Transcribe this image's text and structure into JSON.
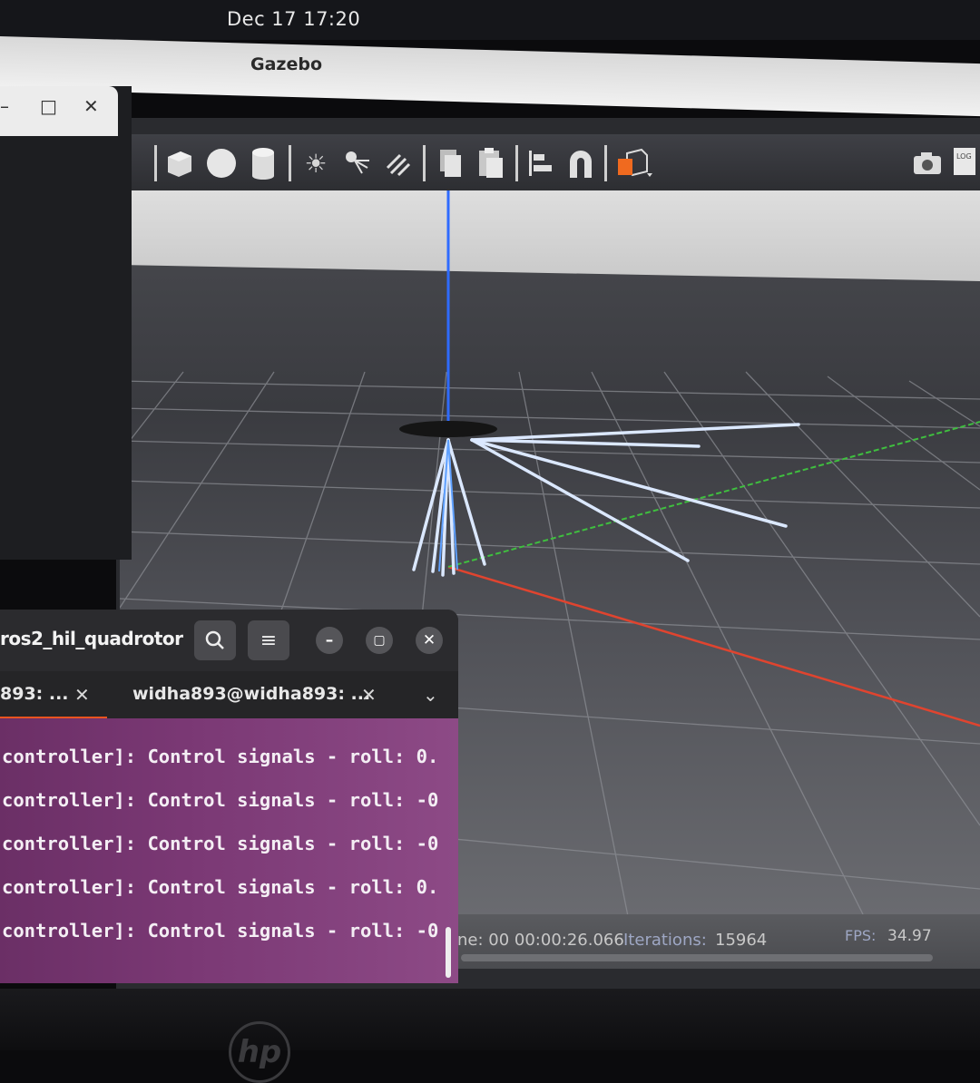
{
  "system_bar": {
    "clock": "Dec 17  17:20"
  },
  "gazebo": {
    "window_title": "Gazebo",
    "toolbar": {
      "tools": [
        "box-icon",
        "sphere-icon",
        "cylinder-icon",
        "point-light-icon",
        "spot-light-icon",
        "directional-light-icon",
        "copy-icon",
        "paste-icon",
        "align-icon",
        "snap-icon",
        "view-angle-icon"
      ],
      "right_tools": [
        "screenshot-icon",
        "log-icon"
      ],
      "log_label": "LOG"
    },
    "status_bar": {
      "sim_time": "ne: 00 00:00:26.066",
      "iterations_label": "Iterations:",
      "iterations_value": "15964",
      "fps_label": "FPS:",
      "fps_value": "34.97"
    },
    "colors": {
      "x_axis": "#e0442f",
      "y_axis": "#3fbf3f",
      "z_axis": "#2f6bff",
      "laser_rays": "#dbe8ff"
    }
  },
  "left_window": {
    "minimize": "–",
    "maximize": "□",
    "close": "✕"
  },
  "terminal": {
    "title": "ros2_hil_quadrotor",
    "tabs": [
      {
        "label": "893: ...",
        "close": "✕"
      },
      {
        "label": "widha893@widha893: ...",
        "close": "✕"
      }
    ],
    "lines": [
      "controller]: Control signals - roll: 0.",
      "controller]: Control signals - roll: -0",
      "controller]: Control signals - roll: -0",
      "controller]: Control signals - roll: 0.",
      "controller]: Control signals - roll: -0"
    ],
    "accent": "#e95420"
  },
  "device": {
    "logo": "hp"
  }
}
